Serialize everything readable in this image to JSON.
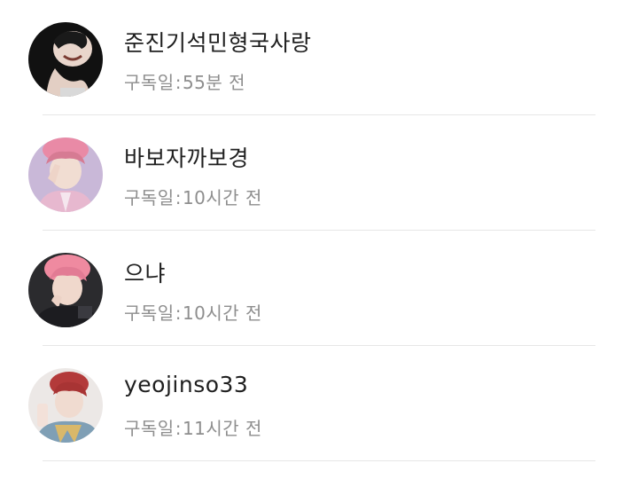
{
  "subscribers": [
    {
      "name": "준진기석민형국사랑",
      "meta_label": "구독일",
      "meta_sep": ":",
      "time": "55분 전",
      "avatar_icon": "avatar-photo"
    },
    {
      "name": "바보자까보경",
      "meta_label": "구독일",
      "meta_sep": ":",
      "time": "10시간 전",
      "avatar_icon": "avatar-photo"
    },
    {
      "name": "으냐",
      "meta_label": "구독일",
      "meta_sep": ":",
      "time": "10시간 전",
      "avatar_icon": "avatar-photo"
    },
    {
      "name": "yeojinso33",
      "meta_label": "구독일",
      "meta_sep": ":",
      "time": "11시간 전",
      "avatar_icon": "avatar-photo"
    }
  ]
}
